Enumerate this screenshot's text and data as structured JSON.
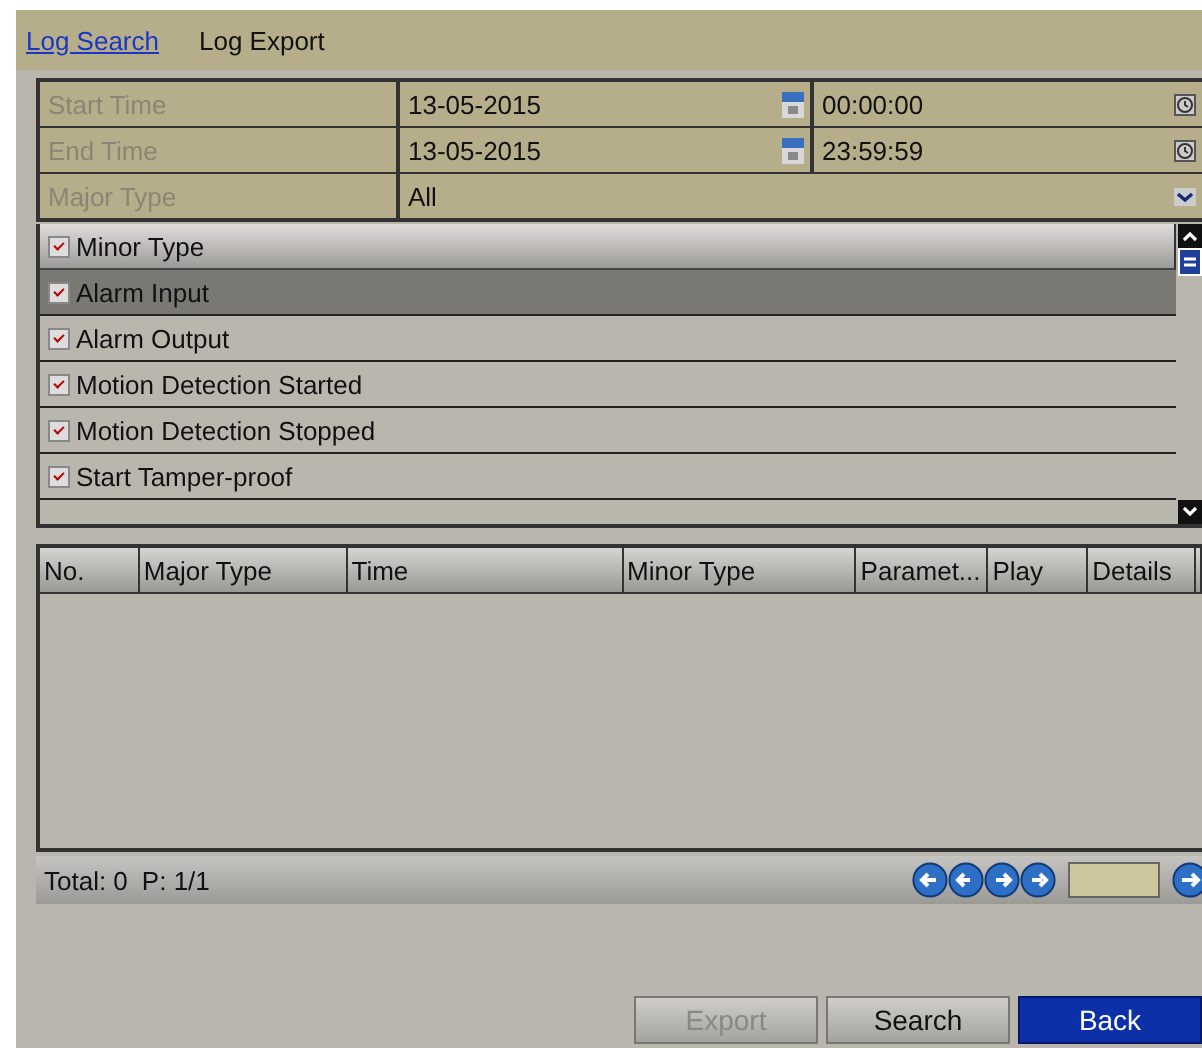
{
  "tabs": [
    {
      "label": "Log Search",
      "selected": true
    },
    {
      "label": "Log Export",
      "selected": false
    }
  ],
  "fields": [
    {
      "label": "Start Time",
      "date": "13-05-2015",
      "time": "00:00:00",
      "kind": "datetime"
    },
    {
      "label": "End Time",
      "date": "13-05-2015",
      "time": "23:59:59",
      "kind": "datetime"
    },
    {
      "label": "Major Type",
      "value": "All",
      "kind": "select"
    }
  ],
  "minor_types": {
    "header": {
      "label": "Minor Type",
      "checked": true
    },
    "items": [
      {
        "label": "Alarm Input",
        "checked": true,
        "selected": true
      },
      {
        "label": "Alarm Output",
        "checked": true,
        "selected": false
      },
      {
        "label": "Motion Detection Started",
        "checked": true,
        "selected": false
      },
      {
        "label": "Motion Detection Stopped",
        "checked": true,
        "selected": false
      },
      {
        "label": "Start Tamper-proof",
        "checked": true,
        "selected": false
      }
    ]
  },
  "table": {
    "columns": [
      "No.",
      "Major Type",
      "Time",
      "Minor Type",
      "Paramet...",
      "Play",
      "Details"
    ]
  },
  "footer": {
    "total": "Total: 0",
    "page": "P: 1/1"
  },
  "buttons": [
    {
      "label": "Export",
      "disabled": true,
      "kind": "normal"
    },
    {
      "label": "Search",
      "disabled": false,
      "kind": "normal"
    },
    {
      "label": "Back",
      "disabled": false,
      "kind": "primary"
    }
  ]
}
